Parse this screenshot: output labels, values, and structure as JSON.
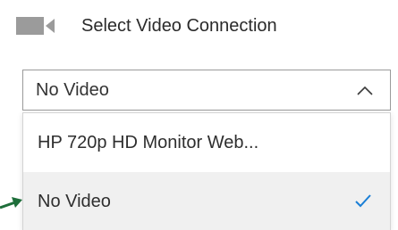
{
  "header": {
    "label": "Select Video Connection",
    "icon": "video-camera-icon"
  },
  "select": {
    "value": "No Video",
    "icon": "chevron-up-icon",
    "expanded": true
  },
  "options": [
    {
      "label": "HP 720p HD Monitor Web...",
      "selected": false
    },
    {
      "label": "No Video",
      "selected": true
    }
  ],
  "colors": {
    "camera_icon": "#9b9b9b",
    "checkmark": "#1a7fd6",
    "pointer_arrow": "#1e6e3a",
    "selected_background": "#f0f0f0"
  }
}
